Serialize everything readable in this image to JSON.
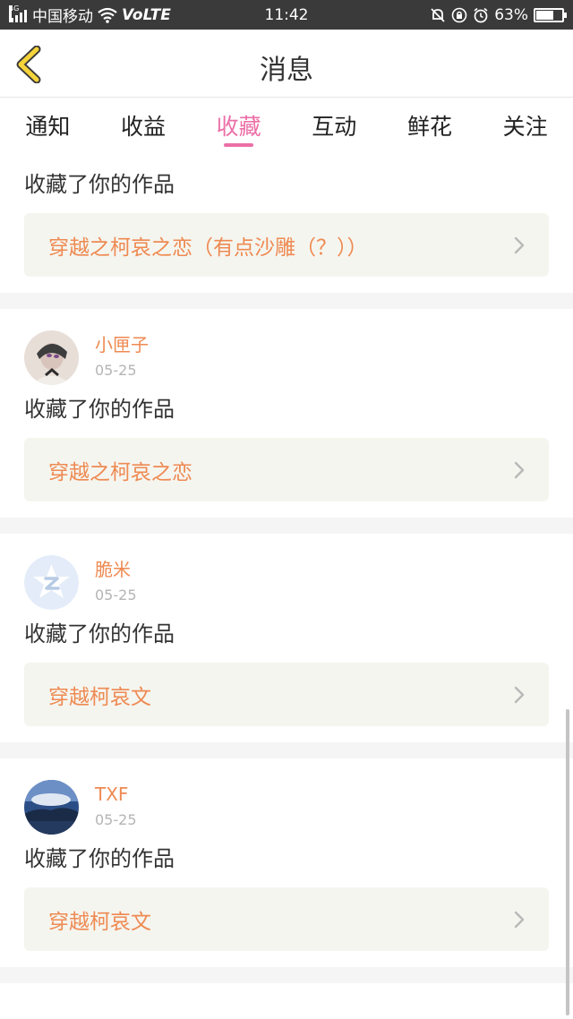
{
  "status_bar": {
    "network_gen": "4G",
    "carrier": "中国移动",
    "volte": "VoLTE",
    "time": "11:42",
    "battery_text": "63%",
    "icons": [
      "signal-icon",
      "wifi-icon",
      "mute-icon",
      "rotation-lock-icon",
      "alarm-icon",
      "battery-icon"
    ]
  },
  "header": {
    "title": "消息",
    "back_icon": "back-chevron-icon",
    "accent": "#f5d33a"
  },
  "tabs": [
    {
      "label": "通知",
      "active": false
    },
    {
      "label": "收益",
      "active": false
    },
    {
      "label": "收藏",
      "active": true
    },
    {
      "label": "互动",
      "active": false
    },
    {
      "label": "鲜花",
      "active": false
    },
    {
      "label": "关注",
      "active": false
    }
  ],
  "colors": {
    "active_tab": "#ec6fa7",
    "username": "#ee8a52",
    "work_box_bg": "#f5f5ef"
  },
  "items": [
    {
      "action": "收藏了你的作品",
      "work": "穿越之柯哀之恋（有点沙雕（？））"
    },
    {
      "user": "小匣子",
      "date": "05-25",
      "action": "收藏了你的作品",
      "work": "穿越之柯哀之恋"
    },
    {
      "user": "脆米",
      "date": "05-25",
      "action": "收藏了你的作品",
      "work": "穿越柯哀文"
    },
    {
      "user": "TXF",
      "date": "05-25",
      "action": "收藏了你的作品",
      "work": "穿越柯哀文"
    }
  ]
}
